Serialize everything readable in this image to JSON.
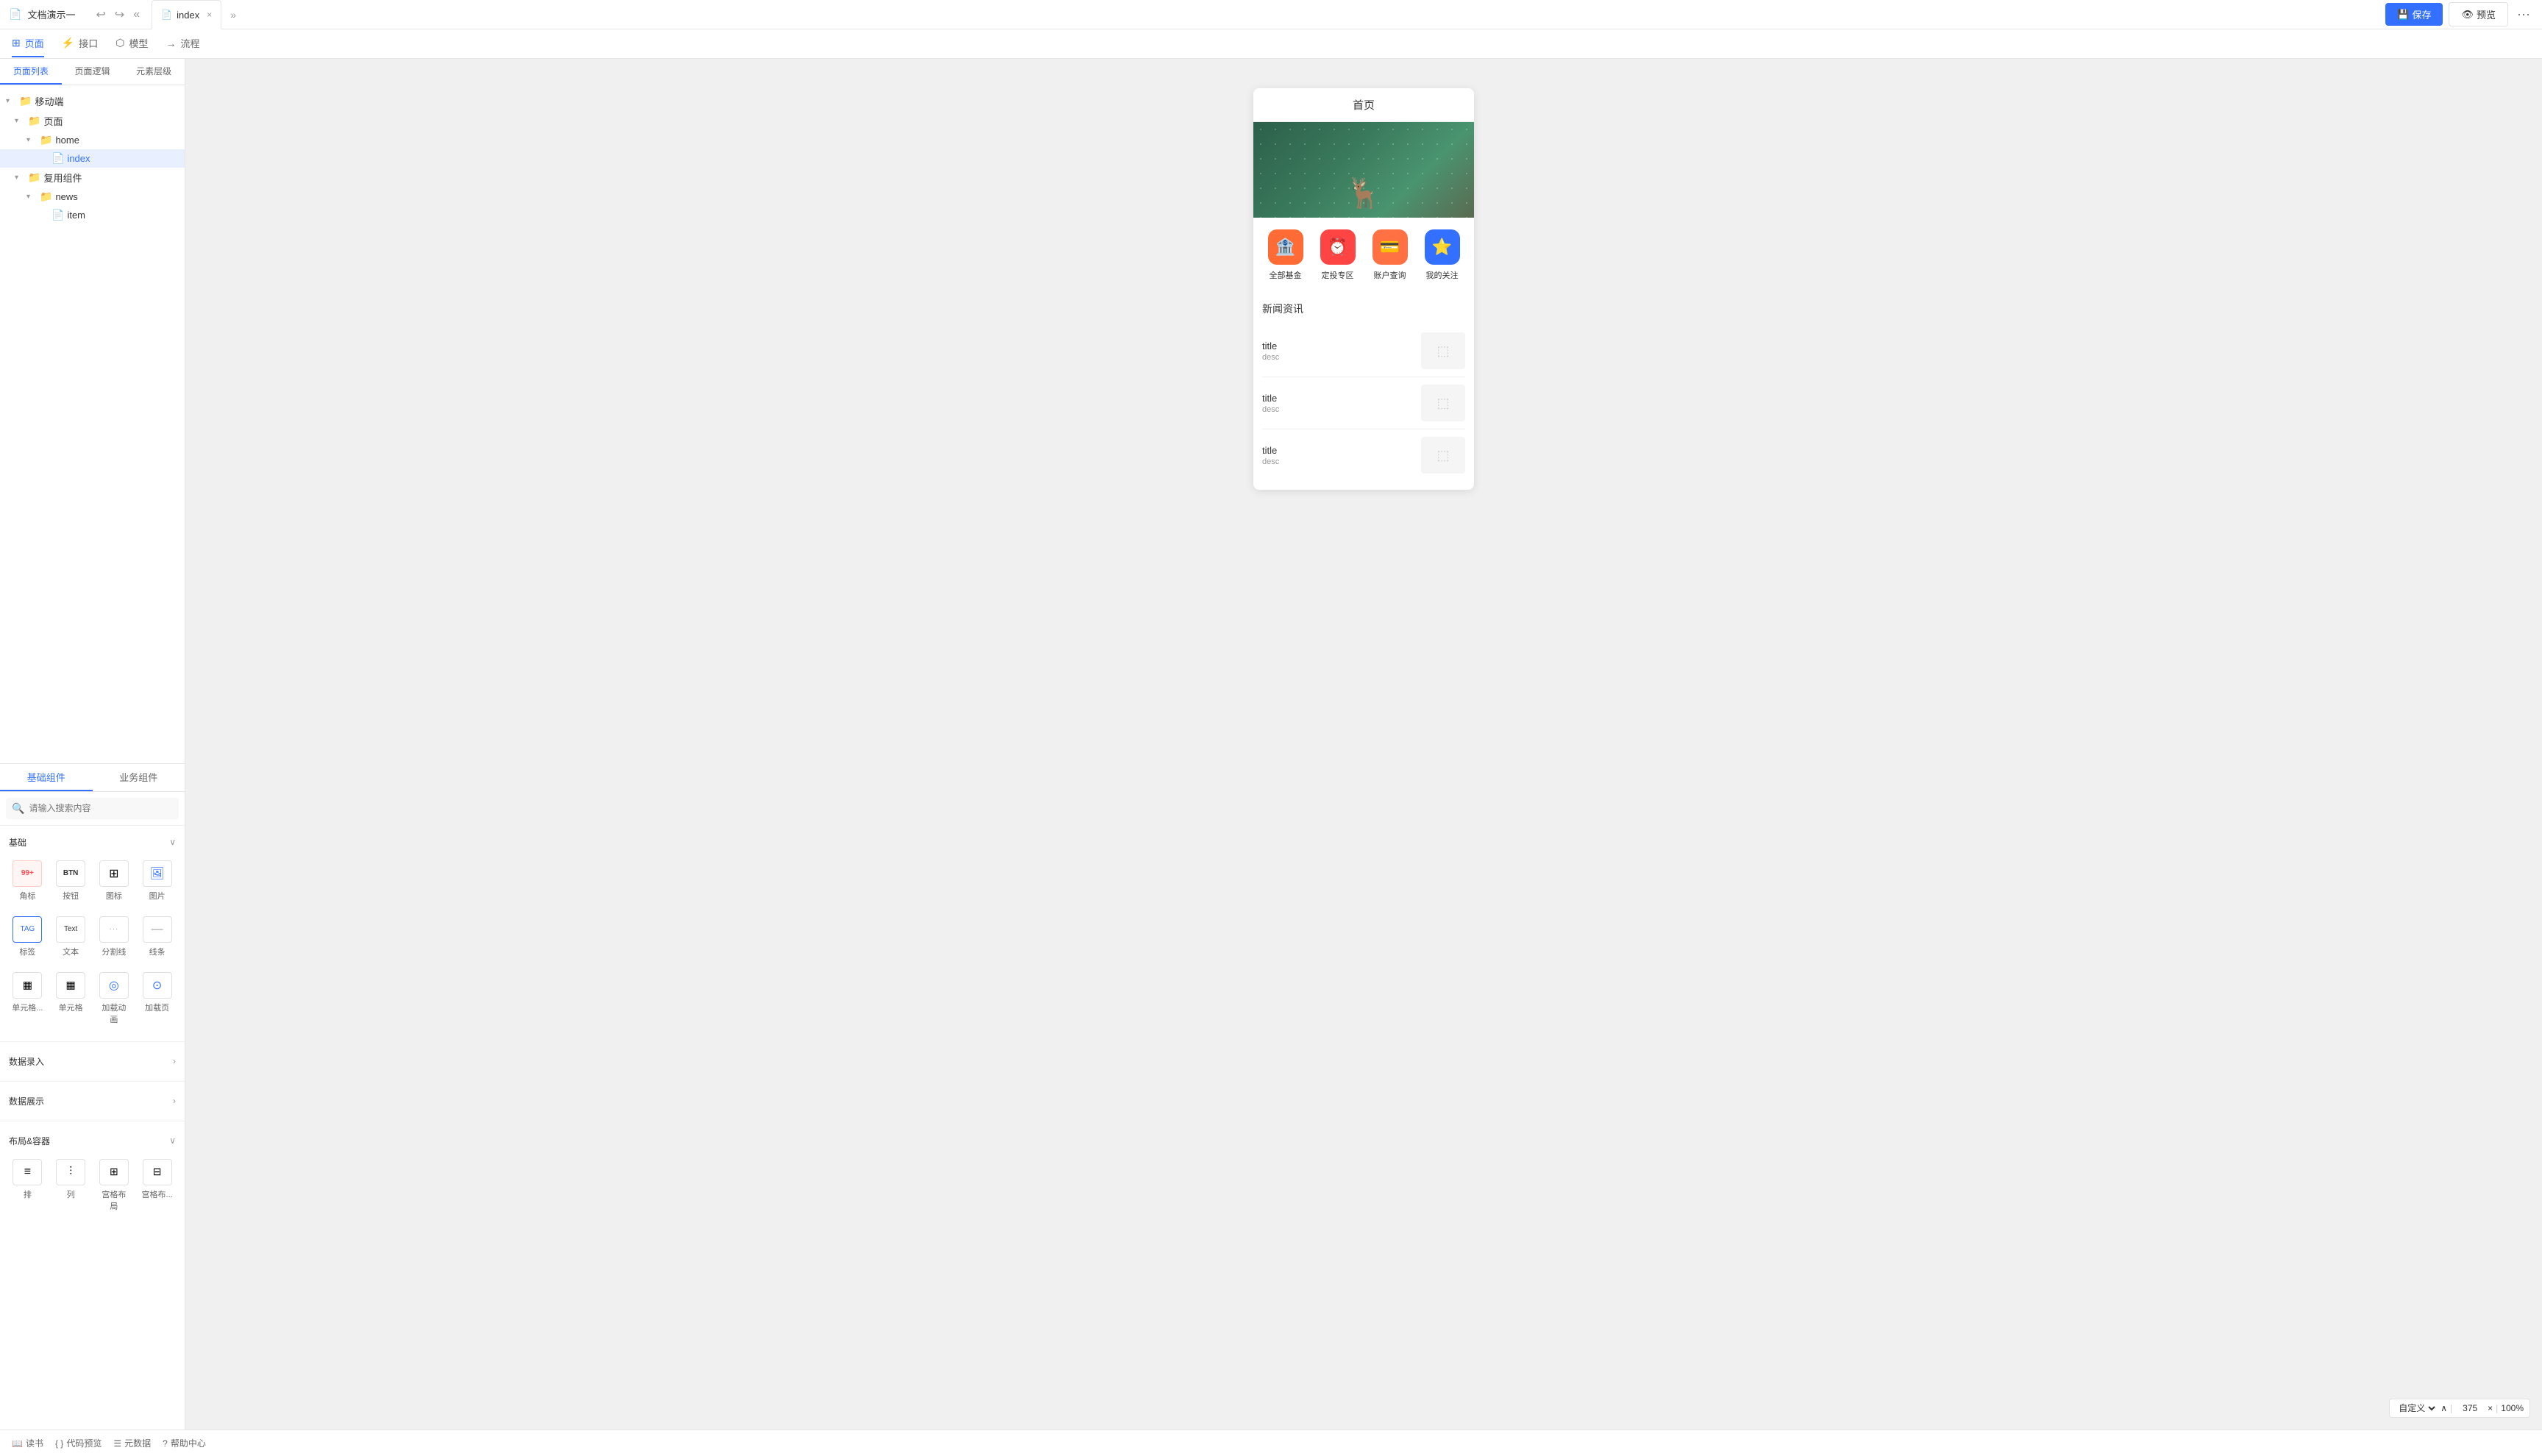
{
  "topbar": {
    "doc_icon": "📄",
    "title": "文档演示一",
    "undo_icon": "↩",
    "redo_icon": "↪",
    "tab_more_icon": "«",
    "tab_label": "index",
    "tab_close": "×",
    "tab_file_icon": "📄",
    "more_tabs_icon": "»",
    "save_label": "保存",
    "save_icon": "💾",
    "preview_label": "预览",
    "preview_icon": "👁",
    "more_icon": "···"
  },
  "subnav": {
    "items": [
      {
        "id": "page",
        "icon": "⊞",
        "label": "页面",
        "active": true
      },
      {
        "id": "api",
        "icon": "⚡",
        "label": "接口",
        "active": false
      },
      {
        "id": "model",
        "icon": "⬡",
        "label": "模型",
        "active": false
      },
      {
        "id": "flow",
        "icon": "→",
        "label": "流程",
        "active": false
      }
    ]
  },
  "left_panel": {
    "tabs": [
      {
        "id": "page-list",
        "label": "页面列表",
        "active": true
      },
      {
        "id": "page-logic",
        "label": "页面逻辑",
        "active": false
      },
      {
        "id": "element-layer",
        "label": "元素层级",
        "active": false
      }
    ],
    "tree": [
      {
        "id": "mobile",
        "indent": 0,
        "arrow": "▾",
        "icon": "📁",
        "label": "移动端",
        "type": "folder"
      },
      {
        "id": "pages",
        "indent": 1,
        "arrow": "▾",
        "icon": "📁",
        "label": "页面",
        "type": "folder"
      },
      {
        "id": "home",
        "indent": 2,
        "arrow": "▾",
        "icon": "📁",
        "label": "home",
        "type": "folder"
      },
      {
        "id": "index",
        "indent": 3,
        "arrow": "",
        "icon": "📄",
        "label": "index",
        "type": "file",
        "active": true,
        "more": "···"
      },
      {
        "id": "reusable",
        "indent": 1,
        "arrow": "▾",
        "icon": "📁",
        "label": "复用组件",
        "type": "folder"
      },
      {
        "id": "news",
        "indent": 2,
        "arrow": "▾",
        "icon": "📁",
        "label": "news",
        "type": "folder"
      },
      {
        "id": "item",
        "indent": 3,
        "arrow": "",
        "icon": "📄",
        "label": "item",
        "type": "file"
      }
    ]
  },
  "canvas": {
    "phone_title": "首页",
    "icons": [
      {
        "id": "all-funds",
        "bg": "#ff6b35",
        "emoji": "🏦",
        "label": "全部基金"
      },
      {
        "id": "fixed-invest",
        "bg": "#ff4444",
        "emoji": "⏰",
        "label": "定投专区"
      },
      {
        "id": "account-query",
        "bg": "#ff7043",
        "emoji": "💳",
        "label": "账户查询"
      },
      {
        "id": "my-follows",
        "bg": "#3370ff",
        "emoji": "⭐",
        "label": "我的关注"
      }
    ],
    "news_section_title": "新闻资讯",
    "news_items": [
      {
        "title": "title",
        "desc": "desc"
      },
      {
        "title": "title",
        "desc": "desc"
      },
      {
        "title": "title",
        "desc": "desc"
      }
    ]
  },
  "component_panel": {
    "tabs": [
      {
        "id": "basic",
        "label": "基础组件",
        "active": true
      },
      {
        "id": "business",
        "label": "业务组件",
        "active": false
      }
    ],
    "search_placeholder": "请输入搜索内容",
    "sections": [
      {
        "id": "basic",
        "title": "基础",
        "collapsed": false,
        "items": [
          {
            "id": "badge",
            "icon": "99+",
            "label": "角标"
          },
          {
            "id": "button",
            "icon": "BTN",
            "label": "按钮"
          },
          {
            "id": "icon-comp",
            "icon": "⊞",
            "label": "图标"
          },
          {
            "id": "image",
            "icon": "🖼",
            "label": "图片"
          },
          {
            "id": "tag",
            "icon": "TAG",
            "label": "标签"
          },
          {
            "id": "text",
            "icon": "Text",
            "label": "文本"
          },
          {
            "id": "divider",
            "icon": "---",
            "label": "分割线"
          },
          {
            "id": "line",
            "icon": "—",
            "label": "线条"
          },
          {
            "id": "single-grid-full",
            "icon": "▦",
            "label": "单元格..."
          },
          {
            "id": "single-grid",
            "icon": "▦",
            "label": "单元格"
          },
          {
            "id": "loading-anim",
            "icon": "◎",
            "label": "加载动画"
          },
          {
            "id": "load-more",
            "icon": "⊙",
            "label": "加载页"
          }
        ]
      },
      {
        "id": "data-entry",
        "title": "数据录入",
        "collapsed": true,
        "items": []
      },
      {
        "id": "data-display",
        "title": "数据展示",
        "collapsed": true,
        "items": []
      },
      {
        "id": "layout-container",
        "title": "布局&容器",
        "collapsed": false,
        "items": [
          {
            "id": "row",
            "icon": "≡",
            "label": "排"
          },
          {
            "id": "col",
            "icon": "⫶",
            "label": "列"
          },
          {
            "id": "grid-a",
            "icon": "⊞",
            "label": "宫格布局"
          },
          {
            "id": "grid-b",
            "icon": "⊟",
            "label": "宫格布..."
          }
        ]
      }
    ]
  },
  "zoom_bar": {
    "preset_label": "自定义",
    "arrow_icon": "∧",
    "width_value": "375",
    "close_icon": "×",
    "zoom_percent": "100%"
  },
  "bottom_bar": {
    "items": [
      {
        "id": "read",
        "icon": "📖",
        "label": "读书"
      },
      {
        "id": "code-preview",
        "icon": "{ }",
        "label": "代码预览"
      },
      {
        "id": "meta-data",
        "icon": "☰",
        "label": "元数据"
      },
      {
        "id": "help",
        "icon": "?",
        "label": "帮助中心"
      }
    ]
  }
}
